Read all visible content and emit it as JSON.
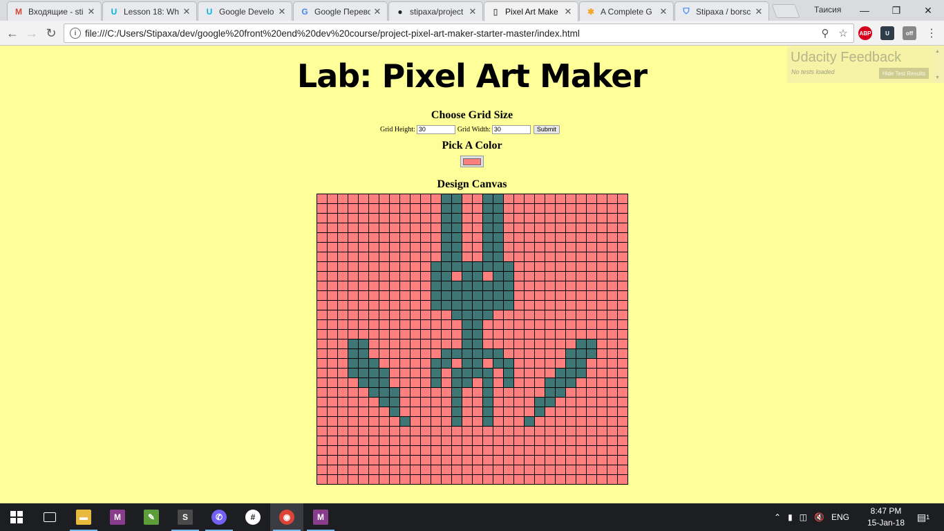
{
  "browser": {
    "tabs": [
      {
        "title": "Входящие - sti",
        "icon": "gmail-icon",
        "active": false
      },
      {
        "title": "Lesson 18: Wh",
        "icon": "udacity-icon",
        "active": false
      },
      {
        "title": "Google Develo",
        "icon": "udacity-icon",
        "active": false
      },
      {
        "title": "Google Перево",
        "icon": "google-translate-icon",
        "active": false
      },
      {
        "title": "stipaxa/project",
        "icon": "github-icon",
        "active": false
      },
      {
        "title": "Pixel Art Make",
        "icon": "page-icon",
        "active": true
      },
      {
        "title": "A Complete G",
        "icon": "asterisk-icon",
        "active": false
      },
      {
        "title": "Stipaxa / borsc",
        "icon": "bitbucket-icon",
        "active": false
      }
    ],
    "tab_close_glyph": "✕",
    "profile_name": "Таисия",
    "window_controls": {
      "minimize": "—",
      "maximize": "❐",
      "close": "✕"
    },
    "address_bar": {
      "url": "file:///C:/Users/Stipaxa/dev/google%20front%20end%20dev%20course/project-pixel-art-maker-starter-master/index.html"
    },
    "extensions": [
      {
        "name": "adblock-plus-icon",
        "label": "ABP",
        "color": "#d6001c"
      },
      {
        "name": "udacity-extension-icon",
        "label": "U",
        "color": "#2e3d49"
      },
      {
        "name": "off-extension-icon",
        "label": "off",
        "color": "#888888"
      }
    ]
  },
  "page": {
    "title": "Lab: Pixel Art Maker",
    "grid_section_title": "Choose Grid Size",
    "grid_height_label": "Grid Height:",
    "grid_height_value": "30",
    "grid_width_label": "Grid Width:",
    "grid_width_value": "30",
    "submit_label": "Submit",
    "color_section_title": "Pick A Color",
    "selected_color": "#ff7f7f",
    "canvas_title": "Design Canvas",
    "canvas": {
      "rows": 30,
      "cols": 30,
      "background_color": "#ff7f7f",
      "paint_color": "#3d7674",
      "painted_runs": [
        [
          [
            12,
            13
          ],
          [
            16,
            17
          ]
        ],
        [
          [
            12,
            13
          ],
          [
            16,
            17
          ]
        ],
        [
          [
            12,
            13
          ],
          [
            16,
            17
          ]
        ],
        [
          [
            12,
            13
          ],
          [
            16,
            17
          ]
        ],
        [
          [
            12,
            13
          ],
          [
            16,
            17
          ]
        ],
        [
          [
            12,
            13
          ],
          [
            16,
            17
          ]
        ],
        [
          [
            12,
            13
          ],
          [
            16,
            17
          ]
        ],
        [
          [
            11,
            18
          ]
        ],
        [
          [
            11,
            12
          ],
          [
            14,
            15
          ],
          [
            17,
            18
          ]
        ],
        [
          [
            11,
            18
          ]
        ],
        [
          [
            11,
            18
          ]
        ],
        [
          [
            11,
            18
          ]
        ],
        [
          [
            13,
            16
          ]
        ],
        [
          [
            14,
            15
          ]
        ],
        [
          [
            14,
            15
          ]
        ],
        [
          [
            3,
            4
          ],
          [
            14,
            15
          ],
          [
            25,
            26
          ]
        ],
        [
          [
            3,
            4
          ],
          [
            12,
            17
          ],
          [
            24,
            26
          ]
        ],
        [
          [
            3,
            5
          ],
          [
            11,
            12
          ],
          [
            14,
            15
          ],
          [
            17,
            18
          ],
          [
            24,
            25
          ]
        ],
        [
          [
            3,
            6
          ],
          [
            11,
            11
          ],
          [
            13,
            16
          ],
          [
            18,
            18
          ],
          [
            23,
            25
          ]
        ],
        [
          [
            4,
            6
          ],
          [
            11,
            11
          ],
          [
            13,
            14
          ],
          [
            16,
            16
          ],
          [
            18,
            18
          ],
          [
            22,
            24
          ]
        ],
        [
          [
            5,
            7
          ],
          [
            13,
            13
          ],
          [
            16,
            16
          ],
          [
            22,
            23
          ]
        ],
        [
          [
            6,
            7
          ],
          [
            13,
            13
          ],
          [
            16,
            16
          ],
          [
            21,
            22
          ]
        ],
        [
          [
            7,
            7
          ],
          [
            13,
            13
          ],
          [
            16,
            16
          ],
          [
            21,
            21
          ]
        ],
        [
          [
            8,
            8
          ],
          [
            13,
            13
          ],
          [
            16,
            16
          ],
          [
            20,
            20
          ]
        ],
        [],
        [],
        [],
        [],
        [],
        []
      ]
    }
  },
  "udacity_feedback": {
    "title": "Udacity Feedback",
    "status": "No tests loaded",
    "button_label": "Hide Test Results"
  },
  "taskbar": {
    "apps": [
      {
        "name": "task-view-icon",
        "glyph": "▭",
        "color": "#1c1e22"
      },
      {
        "name": "file-explorer-icon",
        "glyph": "▬",
        "color": "#e8b93c"
      },
      {
        "name": "mindmap-app-icon",
        "glyph": "M",
        "color": "#8a3c8c"
      },
      {
        "name": "notepad-icon",
        "glyph": "✎",
        "color": "#5c9e3a"
      },
      {
        "name": "sublime-text-icon",
        "glyph": "S",
        "color": "#4a4a4a"
      },
      {
        "name": "viber-icon",
        "glyph": "✆",
        "color": "#7360f2"
      },
      {
        "name": "slack-icon",
        "glyph": "#",
        "color": "#1c1e22"
      },
      {
        "name": "chrome-icon",
        "glyph": "◉",
        "color": "#db4437"
      },
      {
        "name": "mindmap-app-2-icon",
        "glyph": "M",
        "color": "#8a3c8c"
      }
    ],
    "language": "ENG",
    "time": "8:47 PM",
    "date": "15-Jan-18",
    "notification_count": "1"
  }
}
